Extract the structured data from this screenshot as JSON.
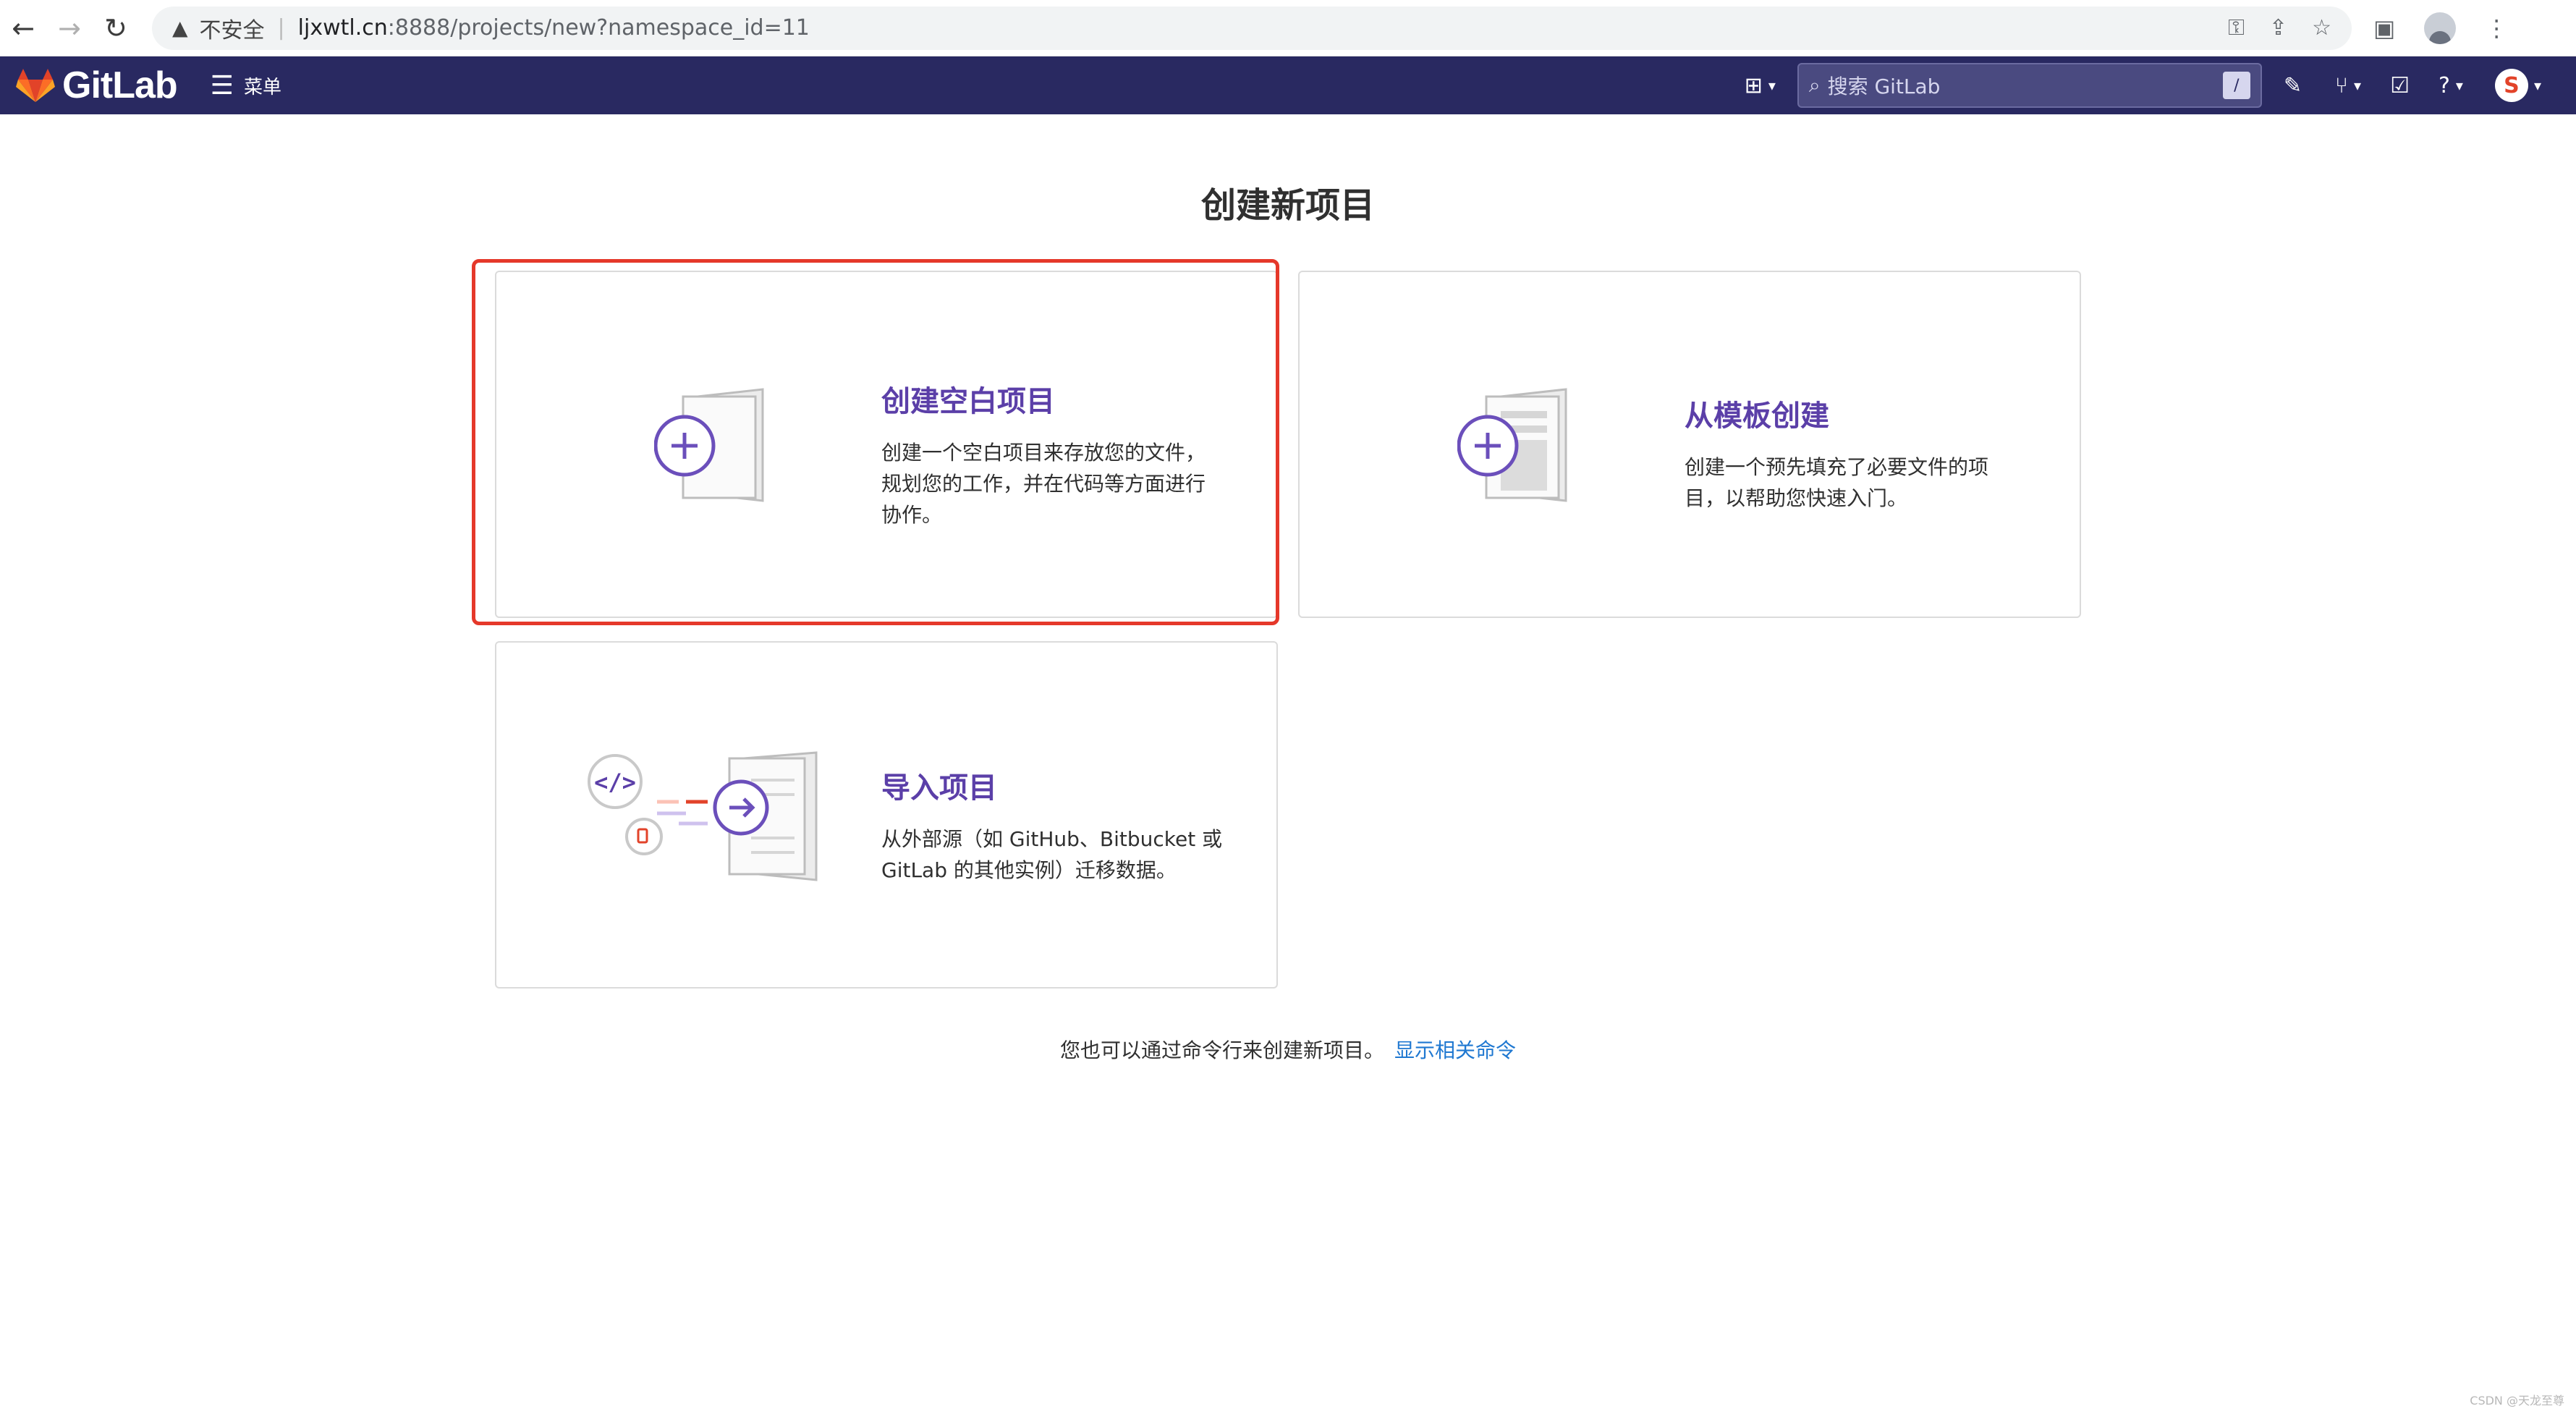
{
  "browser": {
    "security_label": "不安全",
    "url_host": "ljxwtl.cn",
    "url_path": ":8888/projects/new?namespace_id=11"
  },
  "header": {
    "brand": "GitLab",
    "menu_label": "菜单",
    "search_placeholder": "搜索 GitLab",
    "search_shortcut": "/",
    "colors": {
      "navbar": "#292961",
      "logo": "#e24329"
    }
  },
  "main": {
    "title": "创建新项目",
    "cards": [
      {
        "title": "创建空白项目",
        "desc_lines": [
          "创建一个空白项目来存放您的文件，",
          "规划您的工作，并在代码等方面进行",
          "协作。"
        ]
      },
      {
        "title": "从模板创建",
        "desc_lines": [
          "创建一个预先填充了必要文件的项",
          "目，以帮助您快速入门。"
        ]
      },
      {
        "title": "导入项目",
        "desc_lines": [
          "从外部源（如 GitHub、Bitbucket 或",
          "GitLab 的其他实例）迁移数据。"
        ]
      }
    ],
    "cli_hint": "您也可以通过命令行来创建新项目。",
    "cli_link": "显示相关命令"
  },
  "watermark": "CSDN @天龙至尊",
  "accent_colors": {
    "card_title": "#5b3fa8",
    "highlight_border": "#e5382a",
    "link": "#1f78d1"
  }
}
